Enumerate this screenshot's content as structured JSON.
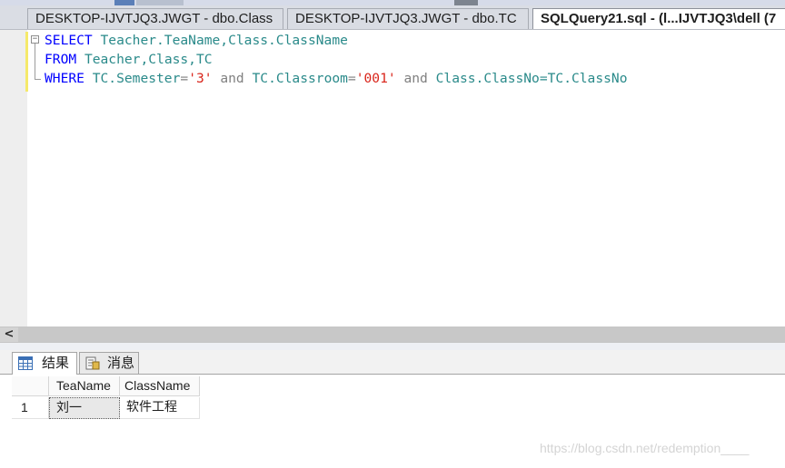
{
  "tabs": [
    {
      "label": "DESKTOP-IJVTJQ3.JWGT - dbo.Class",
      "active": false
    },
    {
      "label": "DESKTOP-IJVTJQ3.JWGT - dbo.TC",
      "active": false
    },
    {
      "label": "SQLQuery21.sql - (l...IJVTJQ3\\dell (7",
      "active": true
    }
  ],
  "editor": {
    "lines": [
      {
        "kw": "SELECT",
        "rest": "Teacher.TeaName,Class.ClassName"
      },
      {
        "kw": "FROM",
        "rest": "Teacher,Class,TC"
      },
      {
        "kw": "WHERE",
        "cond1": "TC.Semester",
        "eq": "=",
        "val1": "'3'",
        "and1": "and",
        "cond2": "TC.Classroom",
        "val2": "'001'",
        "and2": "and",
        "cond3": "Class.ClassNo=TC.ClassNo"
      }
    ],
    "outline_glyph": "−"
  },
  "scrollbar": {
    "left_arrow": "<"
  },
  "results_panel": {
    "results_tab": "结果",
    "messages_tab": "消息",
    "columns": [
      "TeaName",
      "ClassName"
    ],
    "rows": [
      {
        "num": "1",
        "values": [
          "刘一",
          "软件工程"
        ]
      }
    ]
  },
  "watermark": "https://blog.csdn.net/redemption____",
  "colors": {
    "keyword": "#0000ff",
    "identifier": "#2a8a8a",
    "string": "#d9241a",
    "change_bar": "#f5e96a"
  }
}
